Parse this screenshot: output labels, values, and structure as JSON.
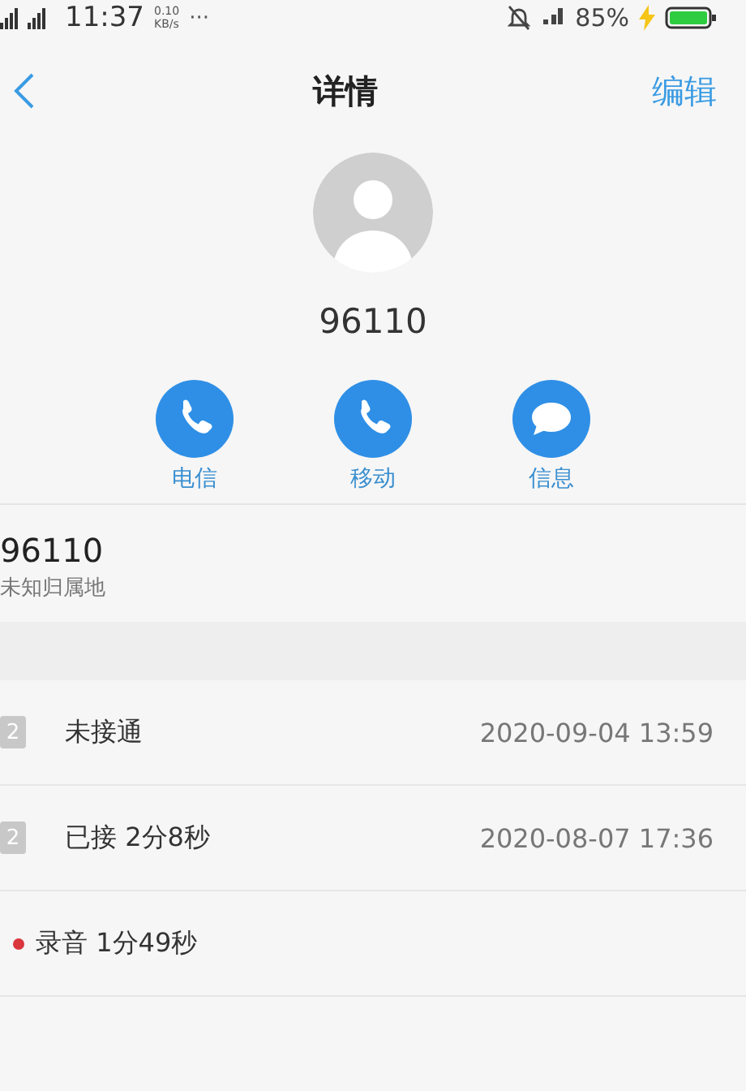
{
  "status_bar": {
    "time": "11:37",
    "speed_value": "0.10",
    "speed_unit": "KB/s",
    "more": "···",
    "battery": "85%",
    "charging": true
  },
  "header": {
    "title": "详情",
    "edit": "编辑"
  },
  "contact": {
    "name": "96110"
  },
  "actions": [
    {
      "kind": "phone",
      "label": "电信"
    },
    {
      "kind": "phone",
      "label": "移动"
    },
    {
      "kind": "message",
      "label": "信息"
    }
  ],
  "number": {
    "value": "96110",
    "location": "未知归属地"
  },
  "calls": [
    {
      "kind": "call",
      "sim": "2",
      "status": "未接通",
      "time": "2020-09-04 13:59"
    },
    {
      "kind": "call",
      "sim": "2",
      "status": "已接 2分8秒",
      "time": "2020-08-07 17:36"
    },
    {
      "kind": "recording",
      "status": "录音 1分49秒",
      "color": "#d9363e"
    }
  ]
}
